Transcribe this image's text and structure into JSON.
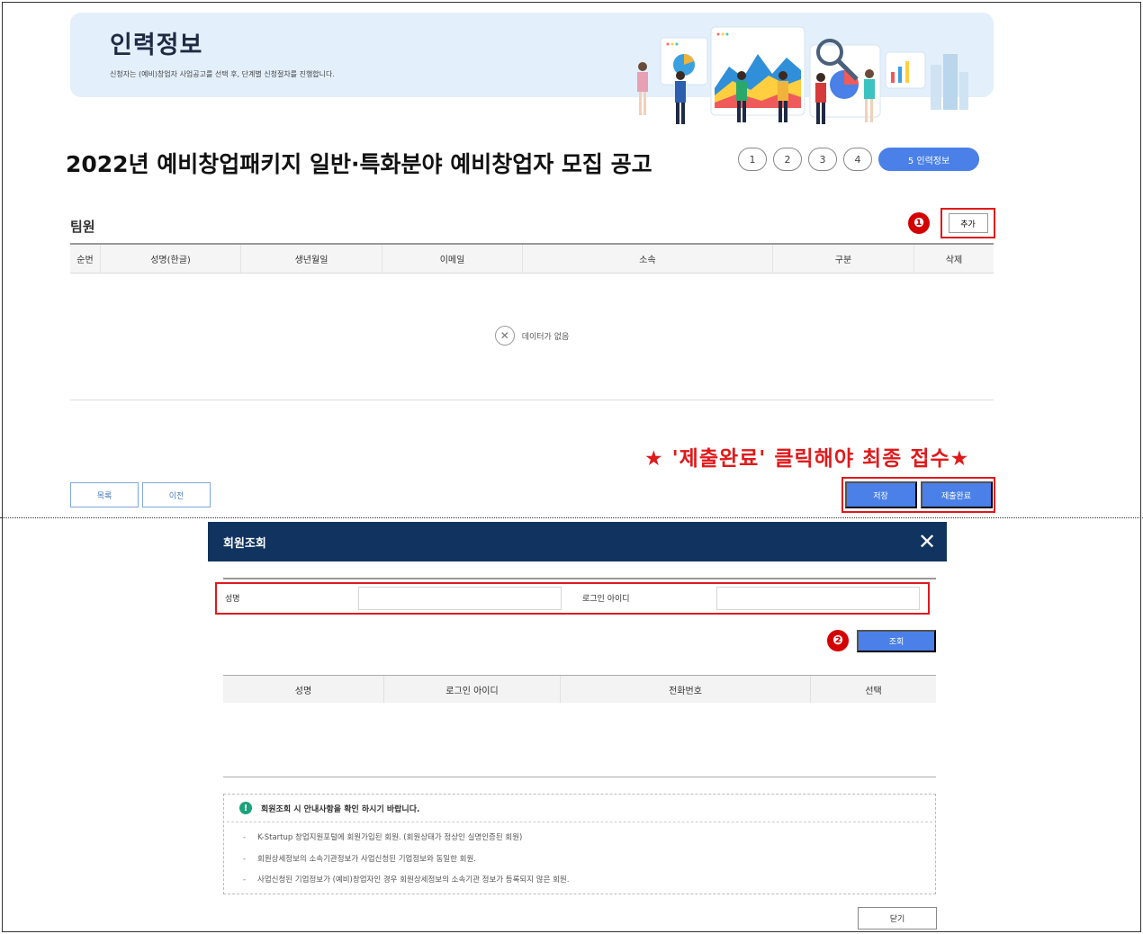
{
  "banner": {
    "title": "인력정보",
    "description": "신청자는 (예비)창업자 사업공고를 선택 후, 단계별 신청절차를 진행합니다."
  },
  "notice": {
    "title": "2022년 예비창업패키지 일반·특화분야 예비창업자 모집 공고"
  },
  "steps": [
    "1",
    "2",
    "3",
    "4",
    "5  인력정보"
  ],
  "team": {
    "label": "팀원",
    "add_label": "추가",
    "columns": [
      "순번",
      "성명(한글)",
      "생년월일",
      "이메일",
      "소속",
      "구분",
      "삭제"
    ],
    "empty_icon": "✕",
    "empty_text": "데이터가 없음"
  },
  "annotations": {
    "badge1": "❶",
    "badge2": "❷",
    "red_note": "★ '제출완료' 클릭해야 최종 접수★"
  },
  "bottom_buttons": {
    "list": "목록",
    "prev": "이전",
    "save": "저장",
    "submit": "제출완료"
  },
  "modal": {
    "title": "회원조회",
    "close_icon": "✕",
    "name_label": "성명",
    "name_value": "",
    "login_label": "로그인 아이디",
    "login_value": "",
    "search_label": "조회",
    "columns": [
      "성명",
      "로그인 아이디",
      "전화번호",
      "선택"
    ],
    "info_icon": "!",
    "info_title": "회원조회 시 안내사항을 확인 하시기 바랍니다.",
    "info_items": [
      "K-Startup 창업지원포털에 회원가입된 회원. (회원상태가 정상인 실명인증된 회원)",
      "회원상세정보의 소속기관정보가 사업신청된 기업정보와 동일한 회원.",
      "사업신청된 기업정보가 (예비)창업자인 경우 회원상세정보의 소속기관 정보가 등록되지 않은 회원."
    ],
    "info_dash": "-",
    "close_label": "닫기"
  },
  "colors": {
    "primary_blue": "#4a80e8",
    "navy": "#10335f",
    "highlight_red": "#e0191b",
    "banner_bg": "#e3f0fb"
  }
}
